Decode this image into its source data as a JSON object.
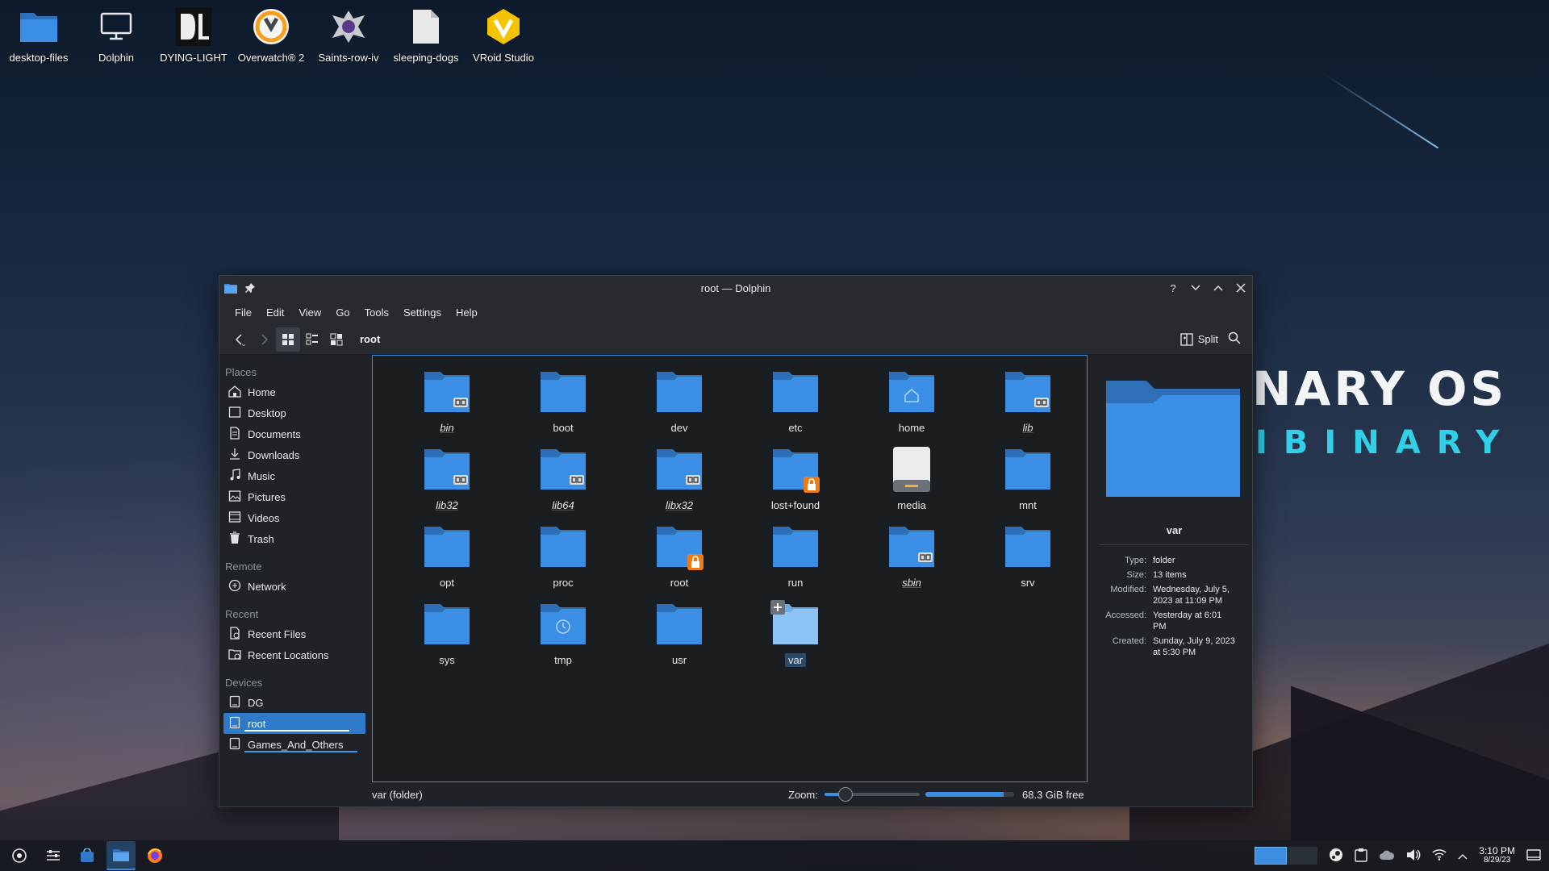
{
  "desktop": {
    "icons": [
      {
        "label": "desktop-files",
        "icon": "folder-icon"
      },
      {
        "label": "Dolphin",
        "icon": "monitor-icon"
      },
      {
        "label": "DYING-LIGHT",
        "icon": "dying-light-icon"
      },
      {
        "label": "Overwatch® 2",
        "icon": "overwatch-icon"
      },
      {
        "label": "Saints-row-iv",
        "icon": "saints-row-icon"
      },
      {
        "label": "sleeping-dogs",
        "icon": "file-icon"
      },
      {
        "label": "VRoid Studio",
        "icon": "vroid-icon"
      }
    ],
    "wallpaper_text": {
      "line1": "NARY OS",
      "line2": "IBINARY"
    }
  },
  "window": {
    "title": "root — Dolphin",
    "menu": [
      "File",
      "Edit",
      "View",
      "Go",
      "Tools",
      "Settings",
      "Help"
    ],
    "breadcrumb": "root",
    "split_label": "Split",
    "places": {
      "sections": [
        {
          "title": "Places",
          "items": [
            {
              "label": "Home",
              "icon": "home-icon"
            },
            {
              "label": "Desktop",
              "icon": "desktop-icon"
            },
            {
              "label": "Documents",
              "icon": "documents-icon"
            },
            {
              "label": "Downloads",
              "icon": "downloads-icon"
            },
            {
              "label": "Music",
              "icon": "music-icon"
            },
            {
              "label": "Pictures",
              "icon": "pictures-icon"
            },
            {
              "label": "Videos",
              "icon": "videos-icon"
            },
            {
              "label": "Trash",
              "icon": "trash-icon"
            }
          ]
        },
        {
          "title": "Remote",
          "items": [
            {
              "label": "Network",
              "icon": "network-icon"
            }
          ]
        },
        {
          "title": "Recent",
          "items": [
            {
              "label": "Recent Files",
              "icon": "recent-files-icon"
            },
            {
              "label": "Recent Locations",
              "icon": "recent-locations-icon"
            }
          ]
        },
        {
          "title": "Devices",
          "items": [
            {
              "label": "DG",
              "icon": "drive-icon"
            },
            {
              "label": "root",
              "icon": "drive-icon"
            },
            {
              "label": "Games_And_Others",
              "icon": "drive-icon"
            }
          ]
        }
      ]
    },
    "files": [
      {
        "name": "bin",
        "italic": true,
        "badge": "link"
      },
      {
        "name": "boot"
      },
      {
        "name": "dev"
      },
      {
        "name": "etc"
      },
      {
        "name": "home",
        "badge": "home"
      },
      {
        "name": "lib",
        "italic": true,
        "badge": "link"
      },
      {
        "name": "lib32",
        "italic": true,
        "badge": "link"
      },
      {
        "name": "lib64",
        "italic": true,
        "badge": "link"
      },
      {
        "name": "libx32",
        "italic": true,
        "badge": "link"
      },
      {
        "name": "lost+found",
        "badge": "lock"
      },
      {
        "name": "media",
        "badge": "drive"
      },
      {
        "name": "mnt"
      },
      {
        "name": "opt"
      },
      {
        "name": "proc"
      },
      {
        "name": "root",
        "badge": "lock"
      },
      {
        "name": "run"
      },
      {
        "name": "sbin",
        "italic": true,
        "badge": "link"
      },
      {
        "name": "srv"
      },
      {
        "name": "sys"
      },
      {
        "name": "tmp",
        "badge": "clock"
      },
      {
        "name": "usr"
      },
      {
        "name": "var",
        "selected": true
      }
    ],
    "info": {
      "name": "var",
      "rows": [
        {
          "key": "Type:",
          "value": "folder"
        },
        {
          "key": "Size:",
          "value": "13 items"
        },
        {
          "key": "Modified:",
          "value": "Wednesday, July 5, 2023 at 11:09 PM"
        },
        {
          "key": "Accessed:",
          "value": "Yesterday at 6:01 PM"
        },
        {
          "key": "Created:",
          "value": "Sunday, July 9, 2023 at 5:30 PM"
        }
      ]
    },
    "status": {
      "text": "var (folder)",
      "zoom_label": "Zoom:",
      "zoom_level": 0.22,
      "free_space": "68.3 GiB free",
      "used_fraction": 0.88
    }
  },
  "taskbar": {
    "time": "3:10 PM",
    "date": "8/29/23"
  },
  "colors": {
    "accent": "#3d8ee0",
    "folder": "#3b8ee6",
    "folder_dark": "#2f6fb8"
  }
}
